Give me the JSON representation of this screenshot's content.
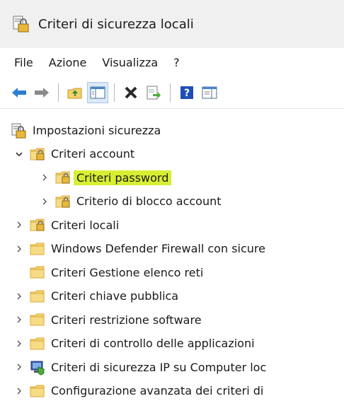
{
  "window": {
    "title": "Criteri di sicurezza locali"
  },
  "menu": [
    "File",
    "Azione",
    "Visualizza",
    "?"
  ],
  "toolbar": {
    "buttons": [
      "back-arrow-icon",
      "forward-arrow-icon",
      "up-folder-icon",
      "show-hide-tree-icon",
      "delete-icon",
      "export-list-icon",
      "help-icon",
      "properties-icon"
    ],
    "colors": {
      "back": "#2b7cd3",
      "forward": "#8a8a8a",
      "delete": "#2a2a2a",
      "help": "#1f4fb5"
    }
  },
  "tree": {
    "root": "Impostazioni sicurezza",
    "items": [
      {
        "label": "Criteri account",
        "level": 1,
        "expander": "expanded",
        "icon": "policy-folder-icon"
      },
      {
        "label": "Criteri password",
        "level": 2,
        "expander": "collapsed",
        "icon": "policy-folder-icon",
        "selected": true
      },
      {
        "label": "Criterio di blocco account",
        "level": 2,
        "expander": "collapsed",
        "icon": "policy-folder-icon"
      },
      {
        "label": "Criteri locali",
        "level": 1,
        "expander": "collapsed",
        "icon": "policy-folder-icon"
      },
      {
        "label": "Windows Defender Firewall con sicure",
        "level": 1,
        "expander": "collapsed",
        "icon": "folder-icon"
      },
      {
        "label": "Criteri Gestione elenco reti",
        "level": 1,
        "expander": "none",
        "icon": "folder-icon"
      },
      {
        "label": "Criteri chiave pubblica",
        "level": 1,
        "expander": "collapsed",
        "icon": "folder-icon"
      },
      {
        "label": "Criteri restrizione software",
        "level": 1,
        "expander": "collapsed",
        "icon": "folder-icon"
      },
      {
        "label": "Criteri di controllo delle applicazioni",
        "level": 1,
        "expander": "collapsed",
        "icon": "folder-icon"
      },
      {
        "label": "Criteri di sicurezza IP su Computer loc",
        "level": 1,
        "expander": "collapsed",
        "icon": "ip-security-icon"
      },
      {
        "label": "Configurazione avanzata dei criteri di",
        "level": 1,
        "expander": "collapsed",
        "icon": "folder-icon"
      }
    ]
  },
  "colors": {
    "selection": "#d7ef32",
    "folder": "#f3d06a",
    "folder_dark": "#d9a93a"
  }
}
